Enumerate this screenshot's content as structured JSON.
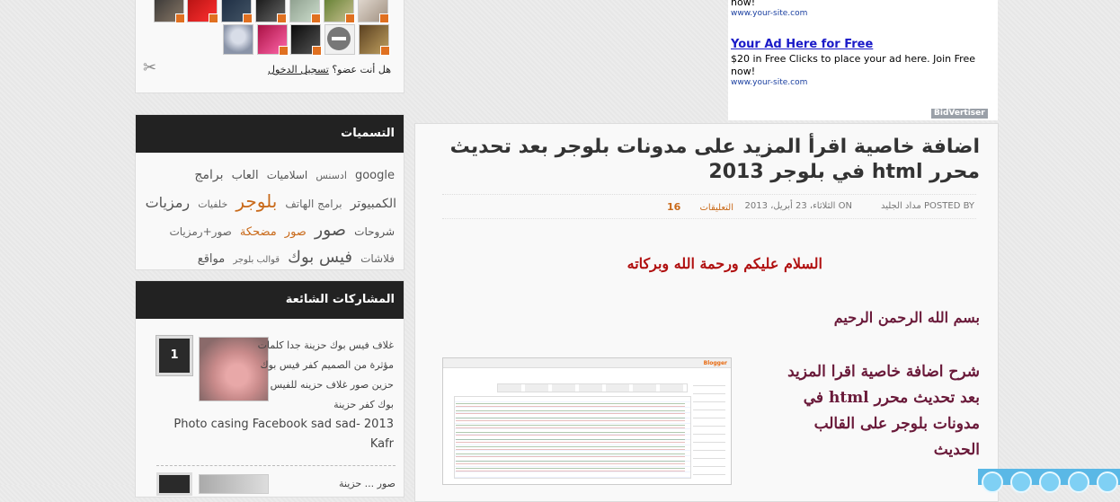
{
  "followers": {
    "member_prompt": "هل أنت عضو؟",
    "login_link": "تسجيل الدخول"
  },
  "labels_widget": {
    "title": "التسميات",
    "tags": [
      {
        "text": "google",
        "size": 13,
        "color": "#555"
      },
      {
        "text": "ادسنس",
        "size": 11,
        "color": "#666"
      },
      {
        "text": "اسلاميات",
        "size": 12,
        "color": "#555"
      },
      {
        "text": "العاب",
        "size": 13,
        "color": "#555"
      },
      {
        "text": "برامج الكمبيوتر",
        "size": 14,
        "color": "#555"
      },
      {
        "text": "برامج الهاتف",
        "size": 12,
        "color": "#666"
      },
      {
        "text": "بلوجر",
        "size": 20,
        "color": "#c96a1a"
      },
      {
        "text": "خلفيات",
        "size": 11,
        "color": "#666"
      },
      {
        "text": "رمزيات",
        "size": 16,
        "color": "#555"
      },
      {
        "text": "شروحات",
        "size": 12,
        "color": "#555"
      },
      {
        "text": "صور",
        "size": 19,
        "color": "#555"
      },
      {
        "text": "صور",
        "size": 13,
        "color": "#c96a1a"
      },
      {
        "text": "مضحكة",
        "size": 13,
        "color": "#c96a1a"
      },
      {
        "text": "صور+رمزيات",
        "size": 12,
        "color": "#666"
      },
      {
        "text": "فلاشات",
        "size": 12,
        "color": "#666"
      },
      {
        "text": "فيس بوك",
        "size": 18,
        "color": "#555"
      },
      {
        "text": "قوالب بلوجر",
        "size": 10,
        "color": "#666"
      },
      {
        "text": "مواقع",
        "size": 13,
        "color": "#555"
      }
    ]
  },
  "popular_widget": {
    "title": "المشاركات الشائعة",
    "items": [
      {
        "rank": "1",
        "text_ar": "غلاف فيس بوك حزينة جدا كلمات مؤثرة من الصميم كفر فيس بوك حزين صور غلاف حزينه للفيس بوك كفر حزينة",
        "text_en": "Photo casing Facebook sad sad- 2013 Kafr"
      },
      {
        "rank": "",
        "text_ar": "صور ... حزينة"
      }
    ]
  },
  "ads": {
    "top_now": "now!",
    "top_domain": "www.your-site.com",
    "title": "Your Ad Here for Free",
    "description": "$20 in Free Clicks to place your ad here. Join Free now!",
    "domain": "www.your-site.com",
    "network": "BidVertiser"
  },
  "post": {
    "title": "اضافة خاصية اقرأ المزيد على مدونات بلوجر بعد تحديث محرر html في بلوجر 2013",
    "posted_by_label": "POSTED BY",
    "author": "مداد الجليد",
    "on_label": "ON",
    "date": "الثلاثاء، 23 أبريل، 2013",
    "comments_count": "16",
    "comments_label": "التعليقات",
    "greeting": "السلام عليكم ورحمة الله وبركاته",
    "basmala": "بسم الله الرحمن الرحيم",
    "explanation": "شرح اضافة خاصية اقرا المزيد بعد تحديث محرر html في مدونات بلوجر على القالب الحديث",
    "screenshot_logo": "Blogger"
  }
}
